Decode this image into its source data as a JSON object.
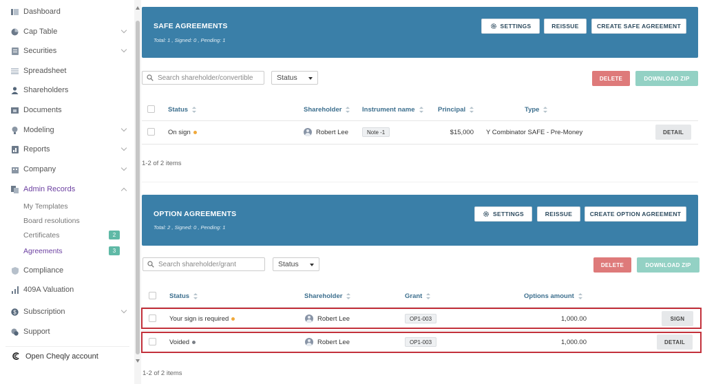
{
  "sidebar": {
    "items": [
      {
        "label": "Dashboard",
        "icon": "dashboard-icon"
      },
      {
        "label": "Cap Table",
        "icon": "pie-chart-icon"
      },
      {
        "label": "Securities",
        "icon": "document-icon"
      },
      {
        "label": "Spreadsheet",
        "icon": "grid-icon"
      },
      {
        "label": "Shareholders",
        "icon": "person-icon"
      },
      {
        "label": "Documents",
        "icon": "folder-icon"
      },
      {
        "label": "Modeling",
        "icon": "bulb-icon"
      },
      {
        "label": "Reports",
        "icon": "report-icon"
      },
      {
        "label": "Company",
        "icon": "building-icon"
      },
      {
        "label": "Admin Records",
        "icon": "records-icon"
      },
      {
        "label": "Compliance",
        "icon": "shield-icon"
      },
      {
        "label": "409A Valuation",
        "icon": "chart-icon"
      },
      {
        "label": "Subscription",
        "icon": "dollar-icon"
      },
      {
        "label": "Support",
        "icon": "support-icon"
      }
    ],
    "sub_items": [
      {
        "label": "My Templates"
      },
      {
        "label": "Board resolutions"
      },
      {
        "label": "Certificates",
        "badge": "2"
      },
      {
        "label": "Agreements",
        "badge": "3"
      }
    ],
    "open_account": "Open Cheqly account"
  },
  "safe": {
    "title": "SAFE AGREEMENTS",
    "summary": "Total: 1 , Signed: 0 , Pending: 1",
    "settings_label": "SETTINGS",
    "reissue_label": "REISSUE",
    "create_label": "CREATE SAFE AGREEMENT",
    "search_placeholder": "Search shareholder/convertible",
    "status_select": "Status",
    "delete_label": "DELETE",
    "download_label": "DOWNLOAD ZIP",
    "columns": [
      "Status",
      "Shareholder",
      "Instrument name",
      "Principal",
      "Type"
    ],
    "rows": [
      {
        "status": "On sign",
        "status_color": "#f0a93c",
        "shareholder": "Robert Lee",
        "instrument": "Note -1",
        "principal": "$15,000",
        "type": "Y Combinator SAFE - Pre-Money",
        "action": "DETAIL"
      }
    ],
    "footer": "1-2 of 2 items"
  },
  "option": {
    "title": "OPTION AGREEMENTS",
    "summary": "Total: 2 , Signed: 0 , Pending: 1",
    "settings_label": "SETTINGS",
    "reissue_label": "REISSUE",
    "create_label": "CREATE OPTION AGREEMENT",
    "search_placeholder": "Search shareholder/grant",
    "status_select": "Status",
    "delete_label": "DELETE",
    "download_label": "DOWNLOAD ZIP",
    "columns": [
      "Status",
      "Shareholder",
      "Grant",
      "Options amount"
    ],
    "rows": [
      {
        "status": "Your sign is required",
        "status_color": "#f0a93c",
        "shareholder": "Robert Lee",
        "grant": "OP1-003",
        "amount": "1,000.00",
        "action": "SIGN"
      },
      {
        "status": "Voided",
        "status_color": "#7a7f86",
        "shareholder": "Robert Lee",
        "grant": "OP1-003",
        "amount": "1,000.00",
        "action": "DETAIL"
      }
    ],
    "footer": "1-2 of 2 items"
  },
  "colors": {
    "accent": "#6b3fa0",
    "banner": "#3a7fa8",
    "highlight": "#c2303a",
    "delete": "#de7a7a",
    "download": "#93d1c4"
  }
}
